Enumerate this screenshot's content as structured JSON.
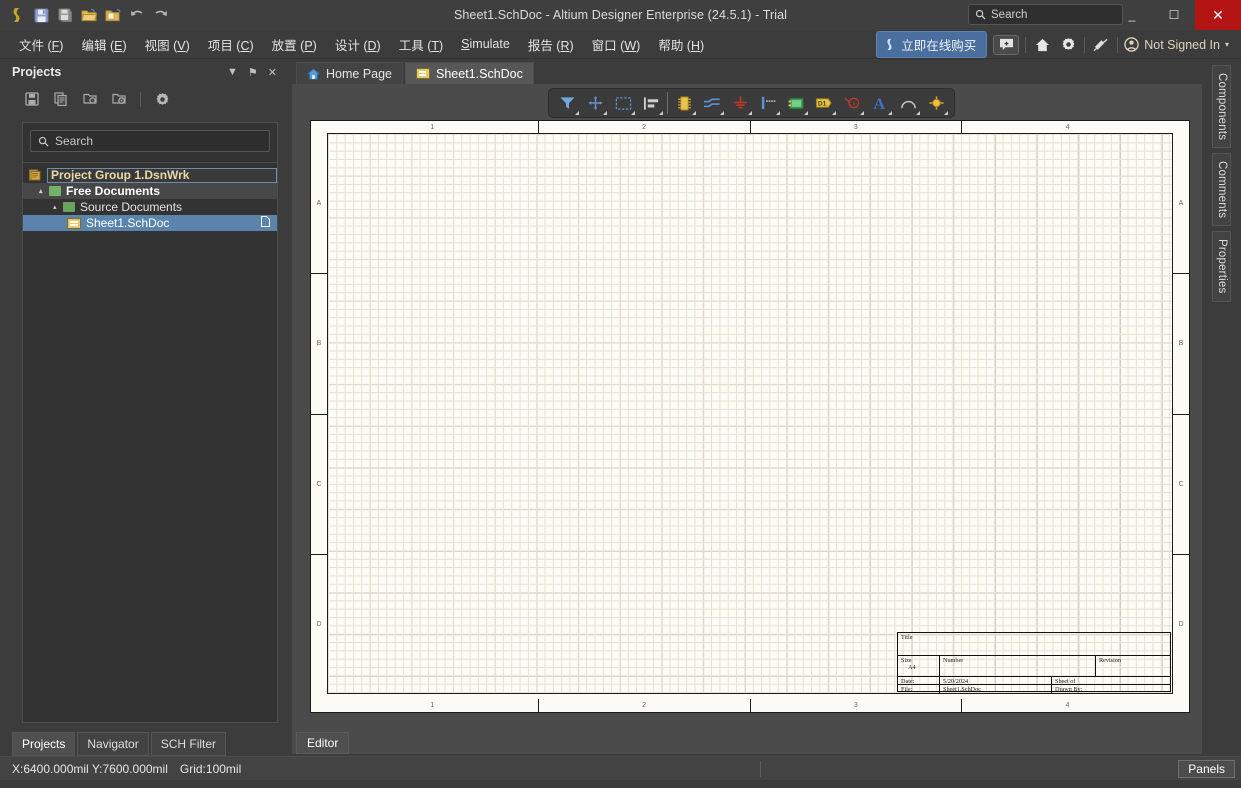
{
  "window": {
    "title": "Sheet1.SchDoc - Altium Designer Enterprise (24.5.1) - Trial",
    "search_placeholder": "Search",
    "minimize": "_",
    "maximize": "☐",
    "close": "✕"
  },
  "quick_access": [
    {
      "name": "altium-logo-icon",
      "label": "A"
    },
    {
      "name": "save-icon",
      "label": "Save"
    },
    {
      "name": "save-all-icon",
      "label": "Save All"
    },
    {
      "name": "open-file-icon",
      "label": "Open"
    },
    {
      "name": "open-project-icon",
      "label": "Open Project"
    },
    {
      "name": "undo-icon",
      "label": "Undo"
    },
    {
      "name": "redo-icon",
      "label": "Redo"
    }
  ],
  "menu": [
    {
      "label": "文件",
      "accel": "F"
    },
    {
      "label": "编辑",
      "accel": "E"
    },
    {
      "label": "视图",
      "accel": "V"
    },
    {
      "label": "项目",
      "accel": "C"
    },
    {
      "label": "放置",
      "accel": "P"
    },
    {
      "label": "设计",
      "accel": "D"
    },
    {
      "label": "工具",
      "accel": "T"
    },
    {
      "label": "Simulate",
      "accel": ""
    },
    {
      "label": "报告",
      "accel": "R"
    },
    {
      "label": "窗口",
      "accel": "W"
    },
    {
      "label": "帮助",
      "accel": "H"
    }
  ],
  "menubar_right": {
    "buy_label": "立即在线购买",
    "signin_label": "Not Signed In",
    "signin_caret": "▾",
    "icons": [
      "comment-add-icon",
      "home-icon",
      "gear-icon",
      "extensions-icon",
      "user-account-icon"
    ]
  },
  "projects_panel": {
    "title": "Projects",
    "header_buttons": [
      "dropdown-caret",
      "pin",
      "close"
    ],
    "header_glyphs": {
      "caret": "▼",
      "pin": "⚑",
      "close": "✕"
    },
    "toolbar_icons": [
      "save-icon",
      "documents-icon",
      "folder-search-icon",
      "folder-settings-icon",
      "gear-icon"
    ],
    "search_placeholder": "Search",
    "tree": [
      {
        "label": "Project Group 1.DsnWrk",
        "level": 0,
        "icon": "workspace-icon",
        "selected": false,
        "editing": true,
        "expander": ""
      },
      {
        "label": "Free Documents",
        "level": 1,
        "icon": "folder-icon",
        "selected": false,
        "editing": false,
        "expander": "▴"
      },
      {
        "label": "Source Documents",
        "level": 2,
        "icon": "folder-icon",
        "selected": false,
        "editing": false,
        "expander": "▴"
      },
      {
        "label": "Sheet1.SchDoc",
        "level": 3,
        "icon": "schematic-doc-icon",
        "selected": true,
        "editing": false,
        "expander": ""
      }
    ],
    "bottom_tabs": [
      {
        "label": "Projects",
        "active": true
      },
      {
        "label": "Navigator",
        "active": false
      },
      {
        "label": "SCH Filter",
        "active": false
      }
    ]
  },
  "document_tabs": [
    {
      "label": "Home Page",
      "icon": "home-icon",
      "active": false
    },
    {
      "label": "Sheet1.SchDoc",
      "icon": "schematic-doc-icon",
      "active": true
    }
  ],
  "schematic_toolbar": [
    {
      "name": "filter-icon",
      "group": 1
    },
    {
      "name": "crosshair-move-icon",
      "group": 1
    },
    {
      "name": "area-select-icon",
      "group": 1
    },
    {
      "name": "align-icon",
      "group": 1
    },
    {
      "name": "place-component-icon",
      "group": 2
    },
    {
      "name": "place-wire-icon",
      "group": 2
    },
    {
      "name": "place-gnd-power-port-icon",
      "group": 2
    },
    {
      "name": "place-bus-entry-icon",
      "group": 2
    },
    {
      "name": "place-sheet-symbol-icon",
      "group": 2
    },
    {
      "name": "place-net-label-icon",
      "group": 2
    },
    {
      "name": "place-no-erc-icon",
      "group": 2
    },
    {
      "name": "place-text-icon",
      "group": 2
    },
    {
      "name": "place-arc-icon",
      "group": 2
    },
    {
      "name": "place-junction-icon",
      "group": 2
    }
  ],
  "sheet": {
    "zones_horizontal": [
      "1",
      "2",
      "3",
      "4"
    ],
    "zones_vertical": [
      "A",
      "B",
      "C",
      "D"
    ],
    "title_block": {
      "title_label": "Title",
      "title_value": "",
      "size_label": "Size",
      "size_value": "A4",
      "number_label": "Number",
      "number_value": "",
      "revision_label": "Revision",
      "revision_value": "",
      "date_label": "Date:",
      "date_value": "5/20/2024",
      "sheet_label": "Sheet   of",
      "sheet_value": "",
      "file_label": "File:",
      "file_value": "Sheet1.SchDoc",
      "drawn_by_label": "Drawn By:",
      "drawn_by_value": ""
    }
  },
  "right_tabs": [
    "Components",
    "Comments",
    "Properties"
  ],
  "editor_tabs": [
    {
      "label": "Editor",
      "active": true
    }
  ],
  "statusbar": {
    "coordinates": "X:6400.000mil Y:7600.000mil",
    "grid": "Grid:100mil",
    "panels_label": "Panels"
  },
  "colors": {
    "chrome": "#3c3c3c",
    "accent_blue": "#5b84ad",
    "buy_button": "#4a6f9e",
    "close_red": "#b51414",
    "sheet_paper": "#fdfbf5",
    "folder_green": "#74b26a",
    "doc_gold": "#e6c866"
  }
}
